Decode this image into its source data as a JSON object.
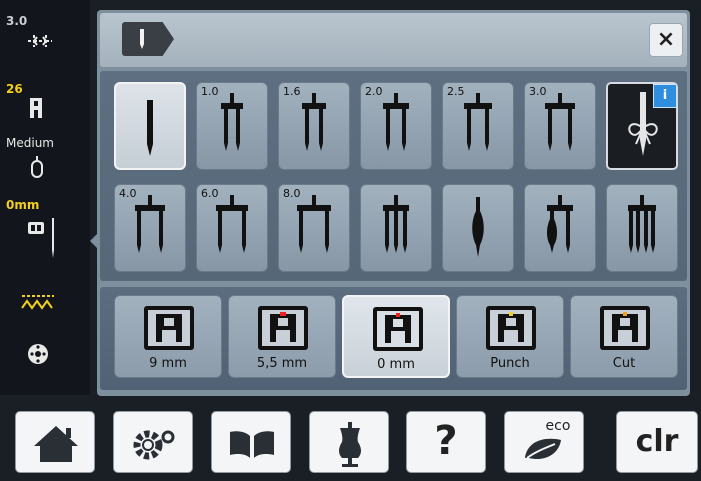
{
  "status": {
    "stitch_width": "3.0",
    "presser_foot": "26",
    "foot_pressure": "Medium",
    "needle_position": "0mm"
  },
  "title": {
    "close_label": "×"
  },
  "needles": [
    {
      "label": "",
      "name": "single"
    },
    {
      "label": "1.0",
      "name": "twin-1-0"
    },
    {
      "label": "1.6",
      "name": "twin-1-6"
    },
    {
      "label": "2.0",
      "name": "twin-2-0"
    },
    {
      "label": "2.5",
      "name": "twin-2-5"
    },
    {
      "label": "3.0",
      "name": "twin-3-0"
    },
    {
      "label": "4.0",
      "name": "twin-4-0"
    },
    {
      "label": "6.0",
      "name": "twin-6-0"
    },
    {
      "label": "8.0",
      "name": "twin-8-0"
    },
    {
      "label": "",
      "name": "triple"
    },
    {
      "label": "",
      "name": "wing"
    },
    {
      "label": "",
      "name": "double-wing"
    },
    {
      "label": "",
      "name": "quadruple"
    }
  ],
  "info_badge": "i",
  "foot_positions": [
    {
      "label": "9 mm",
      "selected": false
    },
    {
      "label": "5,5 mm",
      "selected": false
    },
    {
      "label": "0 mm",
      "selected": true
    },
    {
      "label": "Punch",
      "selected": false
    },
    {
      "label": "Cut",
      "selected": false
    }
  ],
  "toolbar": {
    "eco_label": "eco",
    "help_label": "?",
    "clear_label": "clr"
  },
  "colors": {
    "accent_yellow": "#f3cf1e",
    "info_blue": "#2f8ede",
    "panel_gray": "#7e8f9d"
  }
}
